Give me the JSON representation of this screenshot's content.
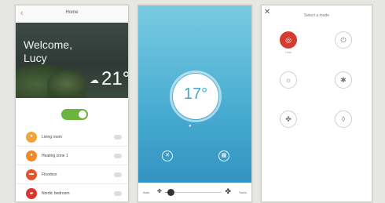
{
  "home": {
    "title": "Home",
    "back_icon": "chevron-left-icon",
    "welcome_line1": "Welcome,",
    "welcome_line2": "Lucy",
    "weather_icon": "cloud-sun-icon",
    "temperature": "21°",
    "master_switch_on": true,
    "rooms": [
      {
        "name": "Living room",
        "status": "",
        "color": "#f3a33a",
        "icon": "ac-icon"
      },
      {
        "name": "Heating zone 1",
        "status": "",
        "color": "#f08a2b",
        "icon": "heat-icon"
      },
      {
        "name": "Floorbox",
        "status": "",
        "color": "#e0572b",
        "icon": "floorbox-icon"
      },
      {
        "name": "Nordic bedroom",
        "status": "",
        "color": "#d8362f",
        "icon": "bed-icon"
      }
    ]
  },
  "thermostat": {
    "title": "",
    "setpoint": "17°",
    "humidity_icon": "drop-icon",
    "humidity": "",
    "controls": [
      {
        "icon": "fan-icon",
        "label_line1": "",
        "label_line2": ""
      },
      {
        "icon": "calendar-icon",
        "label_line1": "",
        "label_line2": ""
      }
    ],
    "fan_speed": {
      "low_label": "Auto",
      "high_label": "Turbo",
      "level": 0.1
    },
    "accent": "#47a6cc"
  },
  "mode": {
    "close_icon": "close-icon",
    "title": "Select a mode",
    "modes": [
      {
        "icon": "heat-icon",
        "label": "Heat",
        "active": true
      },
      {
        "icon": "power-icon",
        "label": "",
        "active": false
      },
      {
        "icon": "sun-icon",
        "label": "",
        "active": false
      },
      {
        "icon": "snowflake-icon",
        "label": "",
        "active": false
      },
      {
        "icon": "fan-icon",
        "label": "",
        "active": false
      },
      {
        "icon": "drop-icon",
        "label": "",
        "active": false
      }
    ],
    "active_color": "#d73b2f"
  }
}
